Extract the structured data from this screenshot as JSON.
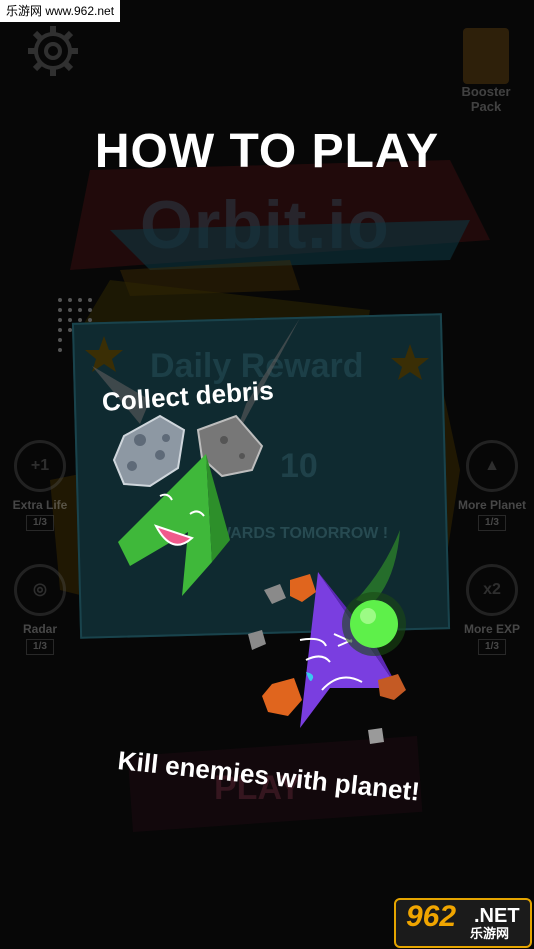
{
  "watermark": {
    "top_text": "乐游网 www.962.net",
    "logo_number": "962",
    "logo_suffix": ".NET",
    "logo_cn": "乐游网"
  },
  "title": "HOW TO PLAY",
  "captions": {
    "collect": "Collect debris",
    "kill": "Kill enemies with planet!"
  },
  "background": {
    "logo": "Orbit.io",
    "booster_label": "Booster Pack",
    "daily": {
      "title": "Daily Reward",
      "count": "10",
      "subtitle": "WARDS TOMORROW !"
    },
    "side_items": [
      {
        "label": "Extra Life",
        "badge": "1/3"
      },
      {
        "label": "Radar",
        "badge": "1/3"
      },
      {
        "label": "More Planet",
        "badge": "1/3"
      },
      {
        "label": "More EXP",
        "badge": "1/3",
        "multiplier": "x2"
      }
    ],
    "play_label": "PLAY"
  },
  "colors": {
    "background": "#070707",
    "player": "#3fb83a",
    "enemy": "#7a3ee0",
    "planet": "#5ef04a",
    "debris": "#e0651e"
  },
  "icons": [
    "settings-icon",
    "gift-icon",
    "heart-icon",
    "radar-icon",
    "star-icon"
  ]
}
